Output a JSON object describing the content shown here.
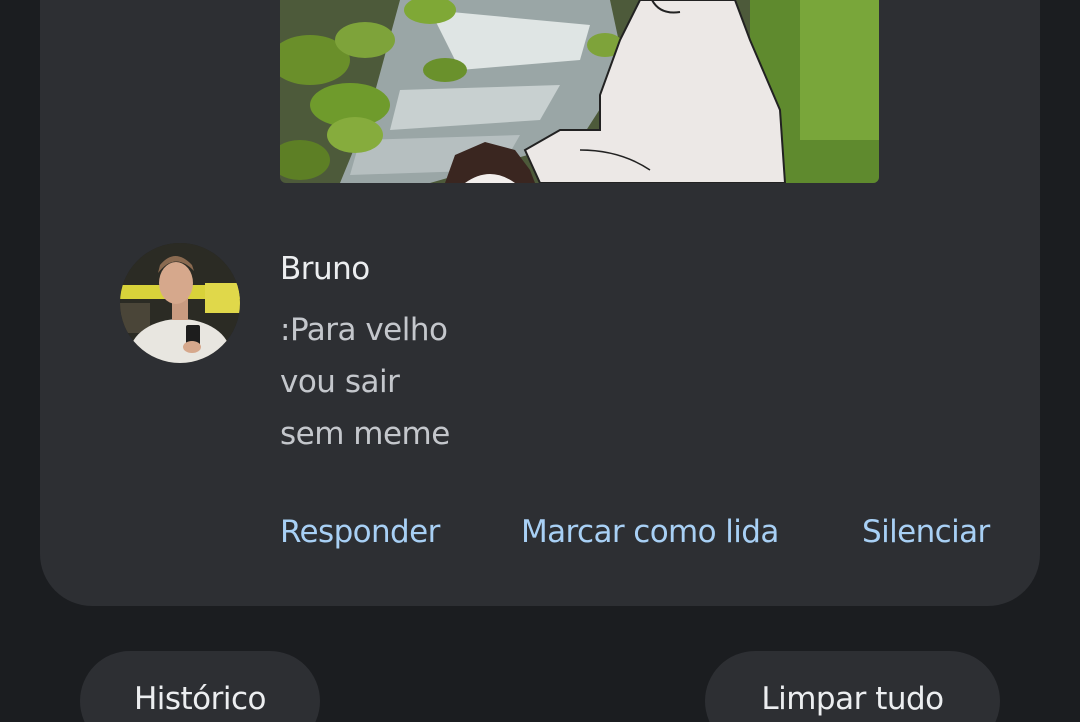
{
  "notification": {
    "sender": "Bruno",
    "message_lines": [
      ":Para velho",
      "vou sair",
      "sem meme"
    ],
    "image": "meme-image",
    "actions": {
      "reply": "Responder",
      "mark_read": "Marcar como lida",
      "mute": "Silenciar"
    }
  },
  "footer": {
    "history": "Histórico",
    "clear_all": "Limpar tudo"
  },
  "colors": {
    "background": "#1b1d20",
    "card": "#2d2f33",
    "action_text": "#a8d0f5",
    "primary_text": "#eceef0",
    "secondary_text": "#c4c7cc"
  }
}
